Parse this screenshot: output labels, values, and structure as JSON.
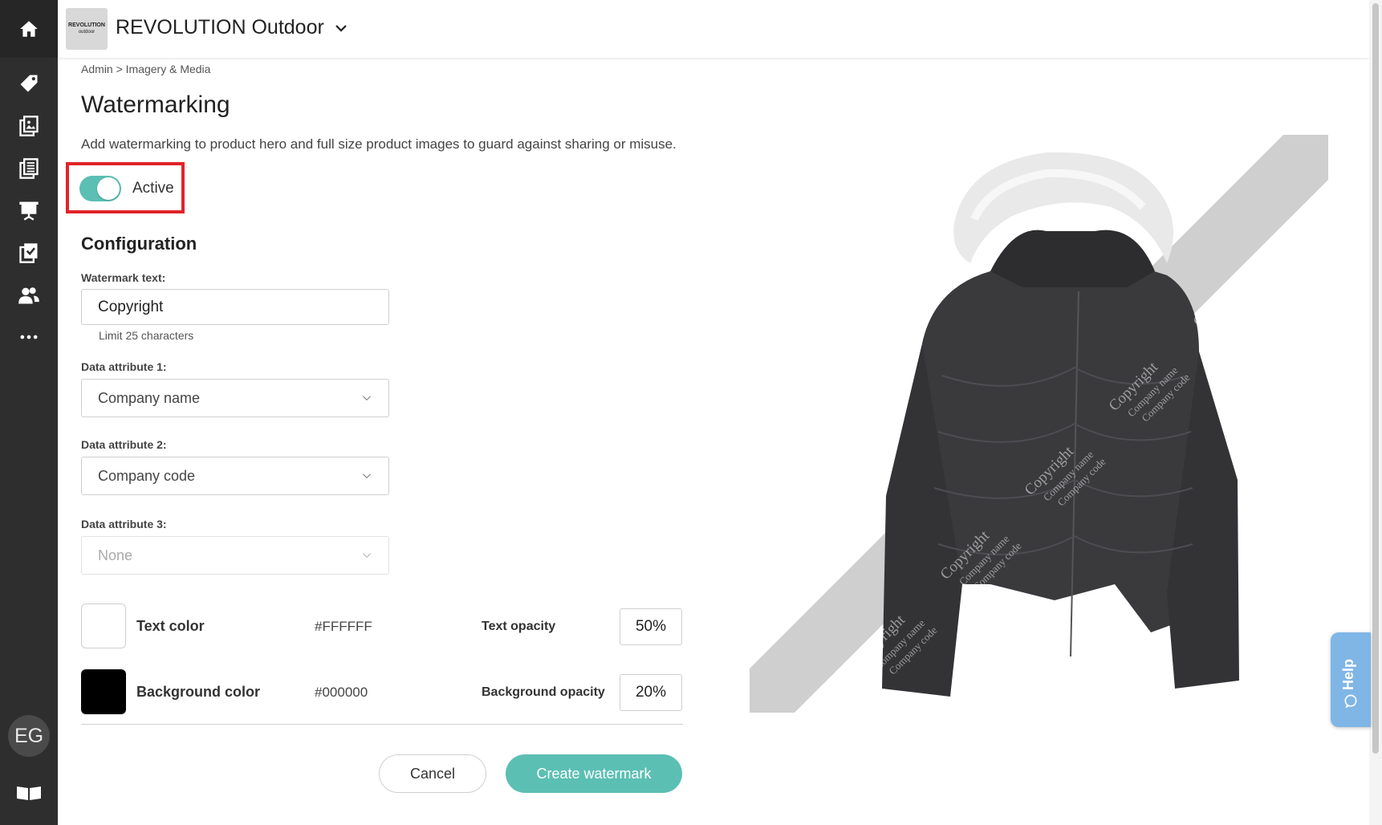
{
  "sidebar": {
    "icons": [
      "home-icon",
      "tag-icon",
      "catalog-icon",
      "document-list-icon",
      "presentation-icon",
      "checklist-icon",
      "users-icon",
      "more-icon"
    ],
    "avatar_initials": "EG",
    "bottom_icon": "book-icon"
  },
  "header": {
    "logo_line1": "REVOLUTION",
    "logo_line2": "outdoor",
    "company": "REVOLUTION Outdoor"
  },
  "breadcrumb": "Admin > Imagery & Media",
  "page": {
    "title": "Watermarking",
    "description": "Add watermarking to product hero and full size product images to guard against sharing or misuse."
  },
  "toggle": {
    "label": "Active",
    "on": true
  },
  "configuration": {
    "heading": "Configuration",
    "watermark_text_label": "Watermark text:",
    "watermark_text_value": "Copyright",
    "watermark_hint": "Limit 25 characters",
    "attr1_label": "Data attribute 1:",
    "attr1_value": "Company name",
    "attr2_label": "Data attribute 2:",
    "attr2_value": "Company code",
    "attr3_label": "Data attribute 3:",
    "attr3_value": "None",
    "text_color_label": "Text color",
    "text_color_hex": "#FFFFFF",
    "text_opacity_label": "Text opacity",
    "text_opacity_value": "50%",
    "bg_color_label": "Background color",
    "bg_color_hex": "#000000",
    "bg_opacity_label": "Background opacity",
    "bg_opacity_value": "20%"
  },
  "buttons": {
    "cancel": "Cancel",
    "create": "Create watermark"
  },
  "preview": {
    "watermark_lines": [
      "Copyright",
      "Company name",
      "Company code"
    ]
  },
  "help": {
    "label": "Help"
  },
  "colors": {
    "accent": "#5bbfb3",
    "sidebar": "#2e2e2e",
    "highlight": "#e0242a",
    "help": "#7fb6e6"
  }
}
